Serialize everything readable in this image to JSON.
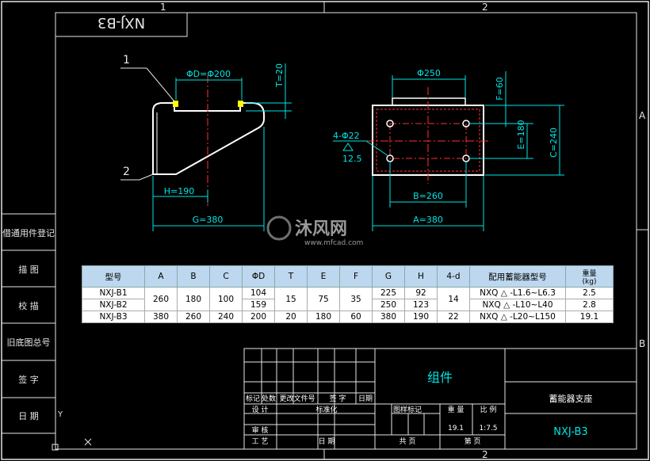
{
  "drawing": {
    "part_code_box": "NXJ-B3",
    "zone_top_1": "1",
    "zone_top_2": "2",
    "zone_bottom_2": "2",
    "zone_right_a": "A",
    "zone_right_b": "B",
    "ucs_y": "Y",
    "watermark": "沐风网",
    "watermark_url": "www.mfcad.com"
  },
  "side_view": {
    "leader_1": "1",
    "leader_2": "2",
    "dim_d": "ΦD=Φ200",
    "dim_t": "T=20",
    "dim_h": "H=190",
    "dim_g": "G=380"
  },
  "top_view": {
    "dim_top": "Φ250",
    "dim_f": "F=60",
    "dim_e": "E=180",
    "dim_c": "C=240",
    "dim_b": "B=260",
    "dim_a": "A=380",
    "hole_label": "4-Φ22",
    "roughness": "12.5"
  },
  "left_column": {
    "items": [
      "借通用件登记",
      "描  图",
      "校  描",
      "旧底图总号",
      "签  字",
      "日  期"
    ]
  },
  "table": {
    "headers": [
      "型号",
      "A",
      "B",
      "C",
      "ΦD",
      "T",
      "E",
      "F",
      "G",
      "H",
      "4-d",
      "配用蓄能器型号",
      "重量\n(kg)"
    ],
    "rows": [
      [
        "NXJ-B1",
        "260",
        "180",
        "100",
        "104",
        "15",
        "75",
        "35",
        "225",
        "92",
        "14",
        "NXQ △ -L1.6~L6.3",
        "2.5"
      ],
      [
        "NXJ-B2",
        "",
        "",
        "",
        "159",
        "",
        "",
        "",
        "250",
        "123",
        "",
        "NXQ △ -L10~L40",
        "2.8"
      ],
      [
        "NXJ-B3",
        "380",
        "260",
        "240",
        "200",
        "20",
        "180",
        "60",
        "380",
        "190",
        "22",
        "NXQ △ -L20~L150",
        "19.1"
      ]
    ]
  },
  "title_block": {
    "name": "组件",
    "product": "蓄能器支座",
    "drawing_no": "NXJ-B3",
    "row_labels": [
      "标记",
      "处数",
      "更改文件号",
      "签  字",
      "日期"
    ],
    "labels2": [
      "设 计",
      "标准化",
      "图样标记",
      "重 量",
      "比 例"
    ],
    "weight": "19.1",
    "scale": "1:7.5",
    "review": "审 核",
    "process": "工 艺",
    "date": "日 期",
    "sheets_total": "共   页",
    "sheet_no": "第   页"
  },
  "colors": {
    "border": "#ffffff",
    "frame": "#00e5e5",
    "dim": "#00e5e5",
    "center": "#ff3030",
    "part": "#ffffff",
    "hatch": "#ffff00",
    "title_text": "#00e5e5",
    "header_bg": "#bdd7ee"
  }
}
